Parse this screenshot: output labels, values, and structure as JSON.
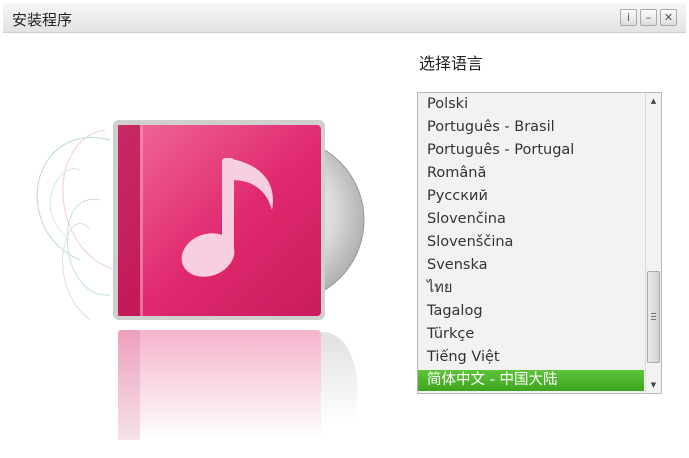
{
  "window": {
    "title": "安装程序",
    "buttons": {
      "info": "i",
      "minimize": "–",
      "close": "✕"
    }
  },
  "main": {
    "language_heading": "选择语言",
    "languages": [
      {
        "label": "Polski"
      },
      {
        "label": "Português - Brasil"
      },
      {
        "label": "Português - Portugal"
      },
      {
        "label": "Română"
      },
      {
        "label": "Русский"
      },
      {
        "label": "Slovenčina"
      },
      {
        "label": "Slovenščina"
      },
      {
        "label": "Svenska"
      },
      {
        "label": "ไทย"
      },
      {
        "label": "Tagalog"
      },
      {
        "label": "Türkçe"
      },
      {
        "label": "Tiếng Việt"
      },
      {
        "label": "简体中文 - 中国大陆"
      }
    ],
    "selected_language": "简体中文 - 中国大陆"
  },
  "icons": {
    "app_icon": "music-album-icon",
    "scroll_up": "▲",
    "scroll_down": "▼"
  },
  "colors": {
    "album_pink": "#e0286e",
    "selection_green": "#4cb52a",
    "titlebar": "#e8e8e8"
  }
}
